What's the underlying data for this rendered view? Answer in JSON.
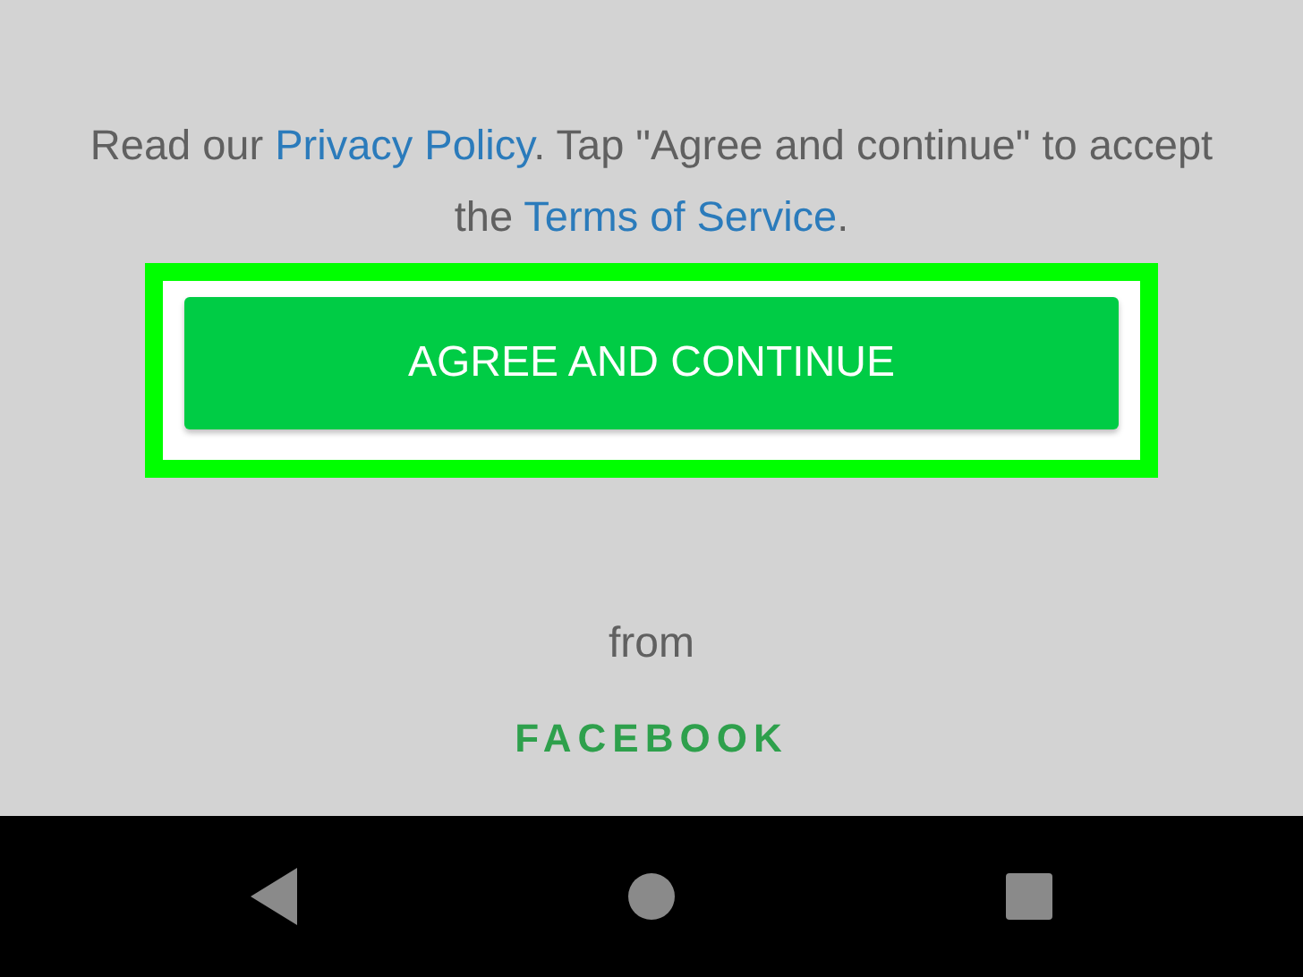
{
  "consent": {
    "segments": [
      {
        "kind": "plain",
        "text": "Read our "
      },
      {
        "kind": "link",
        "text": "Privacy Policy"
      },
      {
        "kind": "plain",
        "text": ". Tap \"Agree and continue\" to accept the "
      },
      {
        "kind": "link",
        "text": "Terms of Service"
      },
      {
        "kind": "plain",
        "text": "."
      }
    ]
  },
  "agree_button": {
    "label": "AGREE AND CONTINUE"
  },
  "footer": {
    "from": "from",
    "brand": "FACEBOOK"
  },
  "nav_bar": {
    "buttons": [
      {
        "kind": "back"
      },
      {
        "kind": "home"
      },
      {
        "kind": "recents"
      }
    ]
  }
}
